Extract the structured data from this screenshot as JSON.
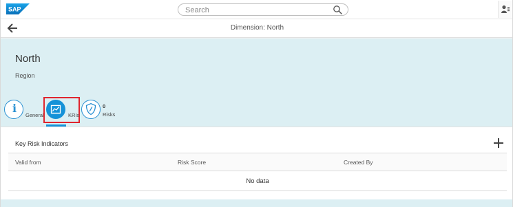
{
  "shell": {
    "logo_text": "SAP",
    "search_placeholder": "Search"
  },
  "subheader": {
    "title": "Dimension: North"
  },
  "object_header": {
    "title": "North",
    "subtitle": "Region"
  },
  "tabs": [
    {
      "label": "General",
      "icon": "info-icon"
    },
    {
      "label": "KRIs",
      "icon": "kri-chart-icon",
      "selected": true
    },
    {
      "label": "Risks",
      "icon": "risk-shield-icon",
      "count": "0"
    }
  ],
  "kri_section": {
    "title": "Key Risk Indicators",
    "columns": [
      "Valid from",
      "Risk Score",
      "Created By"
    ],
    "empty_text": "No data"
  },
  "colors": {
    "accent": "#1592d8",
    "header_bg": "#dceff3",
    "highlight": "#e0252e"
  }
}
